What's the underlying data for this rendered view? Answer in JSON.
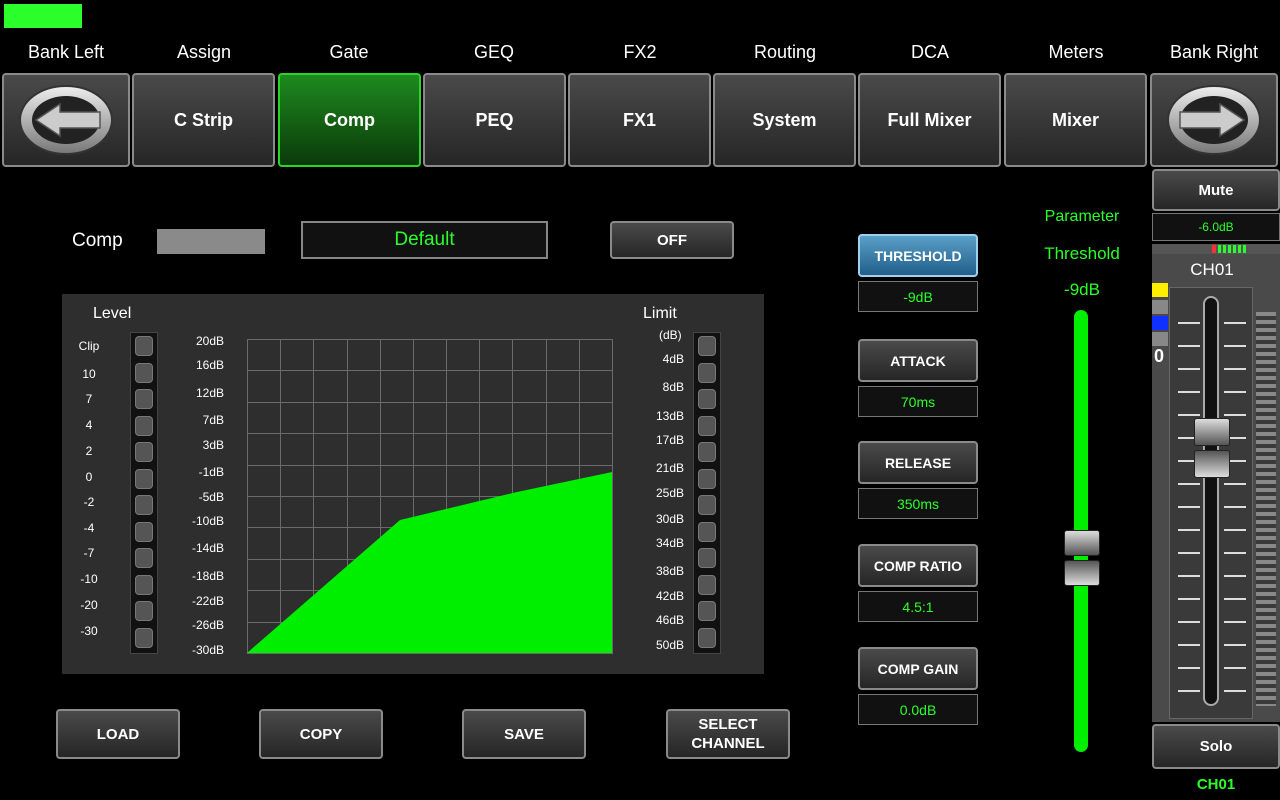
{
  "colors": {
    "accent": "#2bff2b",
    "active_nav": "#1e8a1e",
    "blue_button": "#3a7fb0"
  },
  "top_labels": [
    "Bank Left",
    "Assign",
    "Gate",
    "GEQ",
    "FX2",
    "Routing",
    "DCA",
    "Meters",
    "Bank Right"
  ],
  "nav_buttons": [
    "C Strip",
    "Comp",
    "PEQ",
    "FX1",
    "System",
    "Full Mixer",
    "Mixer"
  ],
  "nav_active": "Comp",
  "comp": {
    "label": "Comp",
    "preset": "Default",
    "off_label": "OFF"
  },
  "graph": {
    "level_label": "Level",
    "limit_label": "Limit",
    "limit_unit": "(dB)",
    "level_scale": [
      "Clip",
      "10",
      "7",
      "4",
      "2",
      "0",
      "-2",
      "-4",
      "-7",
      "-10",
      "-20",
      "-30"
    ],
    "y_scale": [
      "20dB",
      "16dB",
      "12dB",
      "7dB",
      "3dB",
      "-1dB",
      "-5dB",
      "-10dB",
      "-14dB",
      "-18dB",
      "-22dB",
      "-26dB",
      "-30dB"
    ],
    "limit_scale": [
      "4dB",
      "8dB",
      "13dB",
      "17dB",
      "21dB",
      "25dB",
      "30dB",
      "34dB",
      "38dB",
      "42dB",
      "46dB",
      "50dB"
    ]
  },
  "params": [
    {
      "label": "THRESHOLD",
      "value": "-9dB",
      "selected": true
    },
    {
      "label": "ATTACK",
      "value": "70ms"
    },
    {
      "label": "RELEASE",
      "value": "350ms"
    },
    {
      "label": "COMP RATIO",
      "value": "4.5:1"
    },
    {
      "label": "COMP GAIN",
      "value": "0.0dB"
    }
  ],
  "parameter_panel": {
    "title": "Parameter",
    "name": "Threshold",
    "value": "-9dB",
    "slider_fraction": 0.57
  },
  "bottom_buttons": [
    "LOAD",
    "COPY",
    "SAVE",
    "SELECT CHANNEL"
  ],
  "channel": {
    "mute_label": "Mute",
    "level": "-6.0dB",
    "name": "CH01",
    "zero_label": "0",
    "solo_label": "Solo",
    "footer": "CH01",
    "fader_fraction": 0.65
  }
}
